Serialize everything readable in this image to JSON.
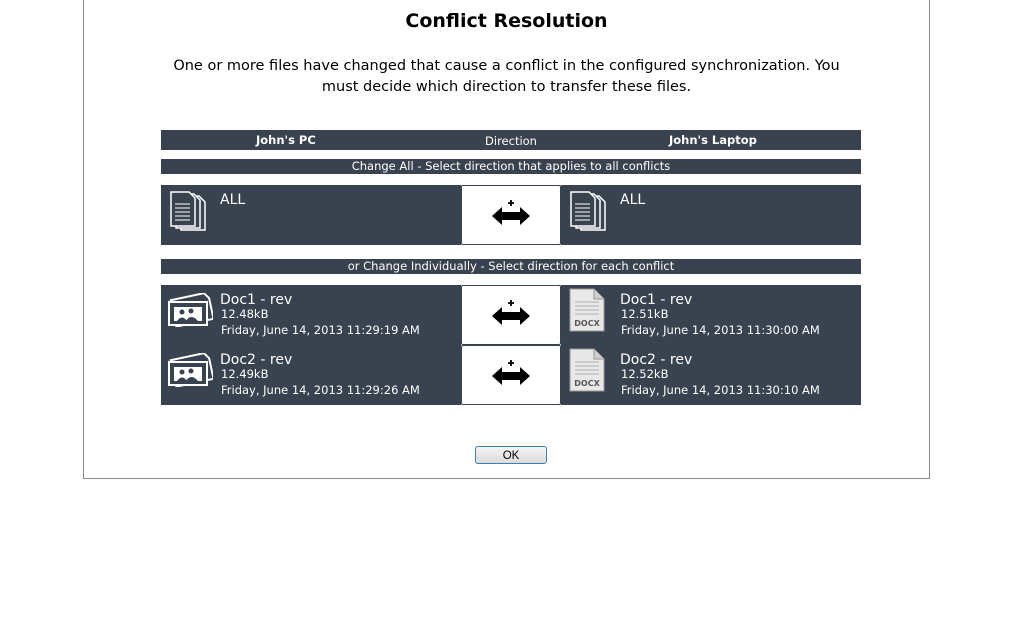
{
  "dialog": {
    "title": "Conflict Resolution",
    "description": "One or more files have changed that cause a conflict in the configured synchronization.  You must decide which direction to transfer these files."
  },
  "header": {
    "left": "John's PC",
    "middle": "Direction",
    "right": "John's Laptop"
  },
  "change_all": {
    "label": "Change All - Select direction that applies to all conflicts",
    "left_name": "ALL",
    "right_name": "ALL"
  },
  "individual": {
    "label": "or Change Individually - Select direction for each conflict",
    "rows": [
      {
        "left": {
          "name": "Doc1 - rev",
          "size": "12.48kB",
          "date": "Friday, June 14, 2013 11:29:19 AM"
        },
        "right": {
          "name": "Doc1 - rev",
          "size": "12.51kB",
          "date": "Friday, June 14, 2013 11:30:00 AM"
        }
      },
      {
        "left": {
          "name": "Doc2 - rev",
          "size": "12.49kB",
          "date": "Friday, June 14, 2013 11:29:26 AM"
        },
        "right": {
          "name": "Doc2 - rev",
          "size": "12.52kB",
          "date": "Friday, June 14, 2013 11:30:10 AM"
        }
      }
    ]
  },
  "icons": {
    "docx_label": "DOCX",
    "all_files": "stacked-files-icon",
    "image_file": "image-file-icon",
    "docx_file": "docx-file-icon",
    "direction": "bidirectional-arrow-icon"
  },
  "ok_label": "OK",
  "colors": {
    "panel": "#394350",
    "button_border": "#3c7fb1"
  }
}
